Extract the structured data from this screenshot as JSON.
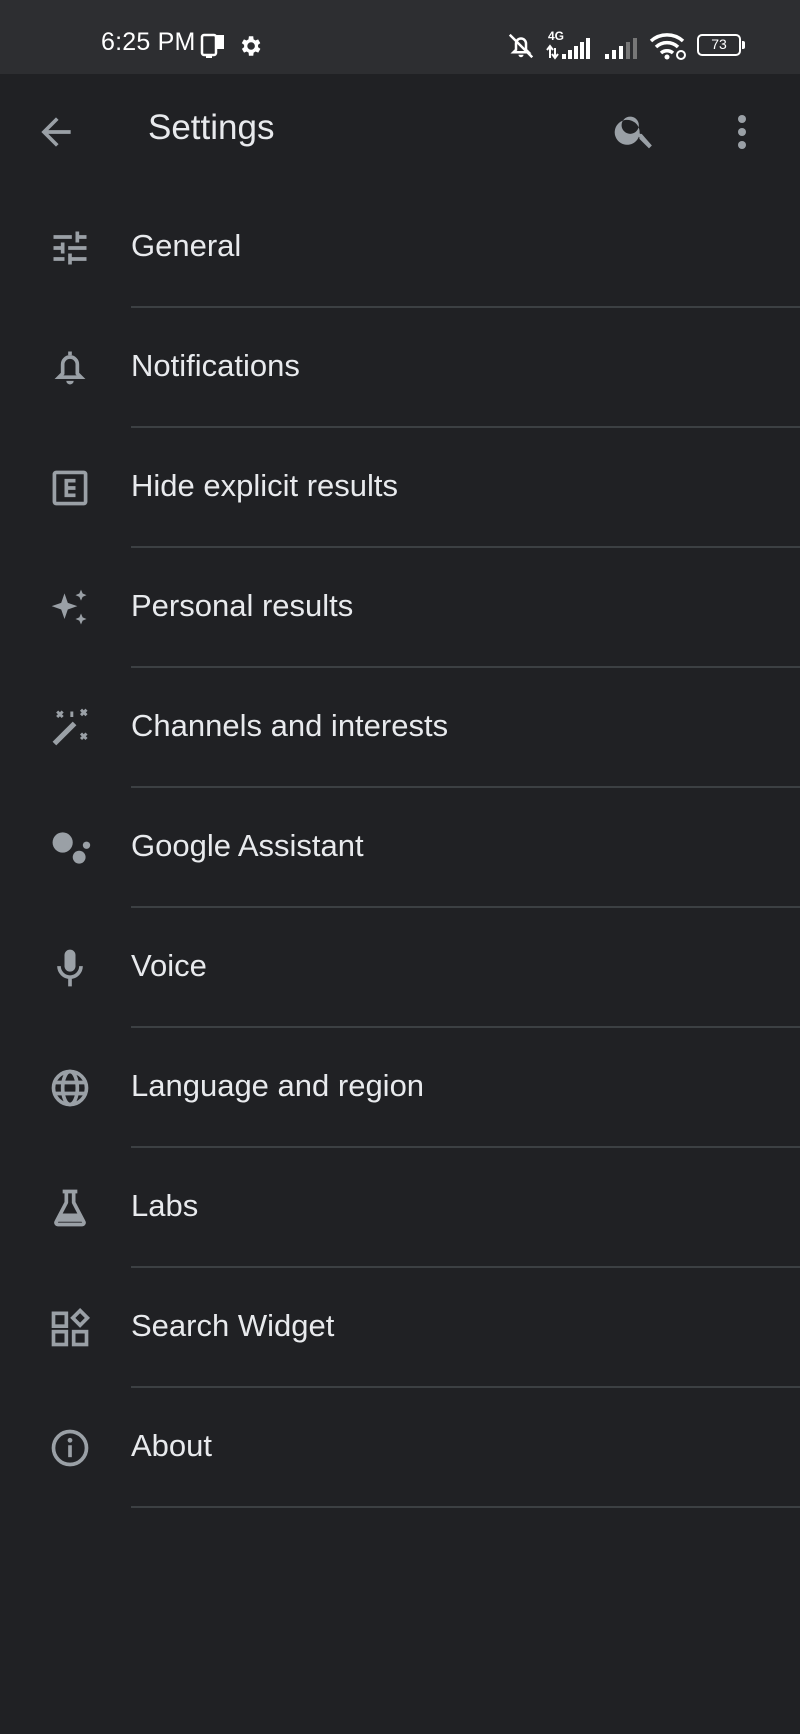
{
  "status_bar": {
    "time": "6:25 PM",
    "network_type": "4G",
    "battery_level": "73",
    "icons": [
      "screen-cast-icon",
      "gear-icon",
      "silent-bell-icon",
      "signal-4g-icon",
      "signal-icon",
      "wifi-icon",
      "battery-icon"
    ]
  },
  "app_bar": {
    "title": "Settings",
    "icons": [
      "back-arrow-icon",
      "search-icon",
      "more-vert-icon"
    ]
  },
  "settings": {
    "items": [
      {
        "label": "General",
        "icon": "tune-icon"
      },
      {
        "label": "Notifications",
        "icon": "bell-icon"
      },
      {
        "label": "Hide explicit results",
        "icon": "explicit-icon"
      },
      {
        "label": "Personal results",
        "icon": "sparkle-icon"
      },
      {
        "label": "Channels and interests",
        "icon": "magic-wand-icon"
      },
      {
        "label": "Google Assistant",
        "icon": "assistant-icon"
      },
      {
        "label": "Voice",
        "icon": "microphone-icon"
      },
      {
        "label": "Language and region",
        "icon": "globe-icon"
      },
      {
        "label": "Labs",
        "icon": "flask-icon"
      },
      {
        "label": "Search Widget",
        "icon": "widgets-icon"
      },
      {
        "label": "About",
        "icon": "info-icon"
      }
    ]
  },
  "colors": {
    "background": "#202124",
    "status_bar": "#2d2e31",
    "text": "#e8eaed",
    "icon": "#9aa0a6",
    "divider": "#3c4043"
  }
}
